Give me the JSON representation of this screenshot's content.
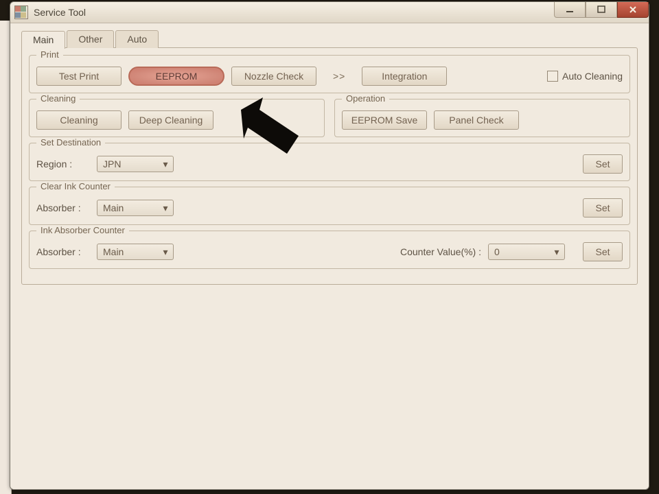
{
  "window": {
    "title": "Service Tool"
  },
  "tabs": {
    "main": "Main",
    "other": "Other",
    "auto": "Auto"
  },
  "print": {
    "legend": "Print",
    "test_print": "Test Print",
    "eeprom": "EEPROM",
    "nozzle_check": "Nozzle Check",
    "more": ">>",
    "integration": "Integration",
    "auto_cleaning": "Auto Cleaning"
  },
  "cleaning": {
    "legend": "Cleaning",
    "cleaning": "Cleaning",
    "deep": "Deep Cleaning"
  },
  "operation": {
    "legend": "Operation",
    "eeprom_save": "EEPROM Save",
    "panel_check": "Panel Check"
  },
  "dest": {
    "legend": "Set Destination",
    "region_label": "Region :",
    "region_value": "JPN",
    "set": "Set"
  },
  "clearink": {
    "legend": "Clear Ink Counter",
    "absorber_label": "Absorber :",
    "absorber_value": "Main",
    "set": "Set"
  },
  "inkabs": {
    "legend": "Ink Absorber Counter",
    "absorber_label": "Absorber :",
    "absorber_value": "Main",
    "counter_label": "Counter Value(%) :",
    "counter_value": "0",
    "set": "Set"
  }
}
